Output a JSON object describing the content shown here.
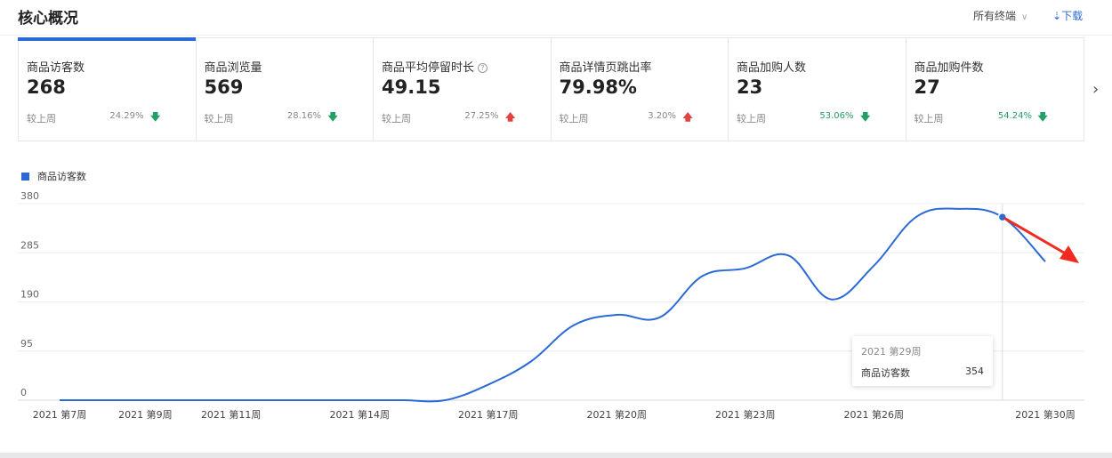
{
  "header": {
    "title": "核心概况",
    "terminal_select": "所有终端",
    "download_label": "下载"
  },
  "cards": [
    {
      "label": "商品访客数",
      "value": "268",
      "compare_label": "较上周",
      "change": "24.29%",
      "direction": "down"
    },
    {
      "label": "商品浏览量",
      "value": "569",
      "compare_label": "较上周",
      "change": "28.16%",
      "direction": "down"
    },
    {
      "label": "商品平均停留时长",
      "value": "49.15",
      "compare_label": "较上周",
      "change": "27.25%",
      "direction": "up",
      "help_icon": "?"
    },
    {
      "label": "商品详情页跳出率",
      "value": "79.98%",
      "compare_label": "较上周",
      "change": "3.20%",
      "direction": "up"
    },
    {
      "label": "商品加购人数",
      "value": "23",
      "compare_label": "较上周",
      "change": "53.06%",
      "direction": "down"
    },
    {
      "label": "商品加购件数",
      "value": "27",
      "compare_label": "较上周",
      "change": "54.24%",
      "direction": "down"
    }
  ],
  "colors": {
    "accent": "#2b6ad6",
    "down": "#23a064",
    "up": "#e34040",
    "annotation": "#f02a1e"
  },
  "chart_data": {
    "type": "line",
    "legend": "商品访客数",
    "y_ticks": [
      "380",
      "285",
      "190",
      "95",
      "0"
    ],
    "ylim": [
      0,
      380
    ],
    "x_tick_labels": [
      "2021 第7周",
      "2021 第9周",
      "2021 第11周",
      "2021 第14周",
      "2021 第17周",
      "2021 第20周",
      "2021 第23周",
      "2021 第26周",
      "2021 第30周"
    ],
    "x_tick_weeks": [
      7,
      9,
      11,
      14,
      17,
      20,
      23,
      26,
      30
    ],
    "xlim": [
      7,
      30
    ],
    "series": [
      {
        "name": "商品访客数",
        "x": [
          7,
          8,
          9,
          10,
          11,
          12,
          13,
          14,
          15,
          16,
          17,
          18,
          19,
          20,
          21,
          22,
          23,
          24,
          25,
          26,
          27,
          28,
          29,
          30
        ],
        "values": [
          0,
          0,
          0,
          0,
          0,
          0,
          0,
          0,
          0,
          0,
          30,
          75,
          145,
          165,
          160,
          240,
          255,
          280,
          195,
          260,
          355,
          370,
          354,
          268
        ]
      }
    ],
    "tooltip": {
      "week": "2021 第29周",
      "name": "商品访客数",
      "value": "354"
    },
    "hover_x": 29
  }
}
